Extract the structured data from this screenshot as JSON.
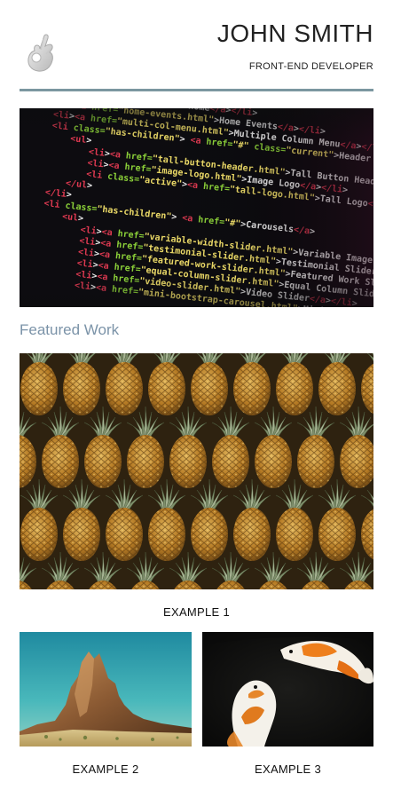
{
  "header": {
    "name": "JOHN SMITH",
    "role": "FRONT-END DEVELOPER",
    "logo_icon": "ok-hand-icon"
  },
  "hero": {
    "image": "code-editor-screenshot",
    "code_lines": [
      "<li><a href=\"index.html\">Home</a></li>",
      "<li><a href=\"home-events.html\">Home Events</a></li>",
      "<li><a href=\"multi-col-menu.html\">Multiple Column Menu</a></li>",
      "<li class=\"has-children\"> <a href=\"#\" class=\"current\">Header Options</a>",
      "<ul>",
      "<li><a href=\"tall-button-header.html\">Tall Button Header</a></li>",
      "<li><a href=\"image-logo.html\">Image Logo</a></li>",
      "<li class=\"active\"><a href=\"tall-logo.html\">Tall Logo</a></li>",
      "</ul>",
      "</li>",
      "<li class=\"has-children\"> <a href=\"#\">Carousels</a>",
      "<ul>",
      "<li><a href=\"variable-width-slider.html\">Variable Image Width</a></li>",
      "<li><a href=\"testimonial-slider.html\">Testimonial Slider</a></li>",
      "<li><a href=\"featured-work-slider.html\">Featured Work Slider</a></li>",
      "<li><a href=\"equal-column-slider.html\">Equal Column Slider</a></li>",
      "<li><a href=\"video-slider.html\">Video Slider</a></li>",
      "<li><a href=\"mini-bootstrap-carousel.html\">Mini Slider</a></li>"
    ]
  },
  "featured": {
    "title": "Featured Work",
    "items": [
      {
        "label": "EXAMPLE 1",
        "image": "pineapples-photo"
      },
      {
        "label": "EXAMPLE 2",
        "image": "desert-rock-photo"
      },
      {
        "label": "EXAMPLE 3",
        "image": "koi-fish-photo"
      }
    ]
  },
  "colors": {
    "accent": "#7b97a0",
    "section_title": "#7b93a8",
    "text": "#222222"
  }
}
